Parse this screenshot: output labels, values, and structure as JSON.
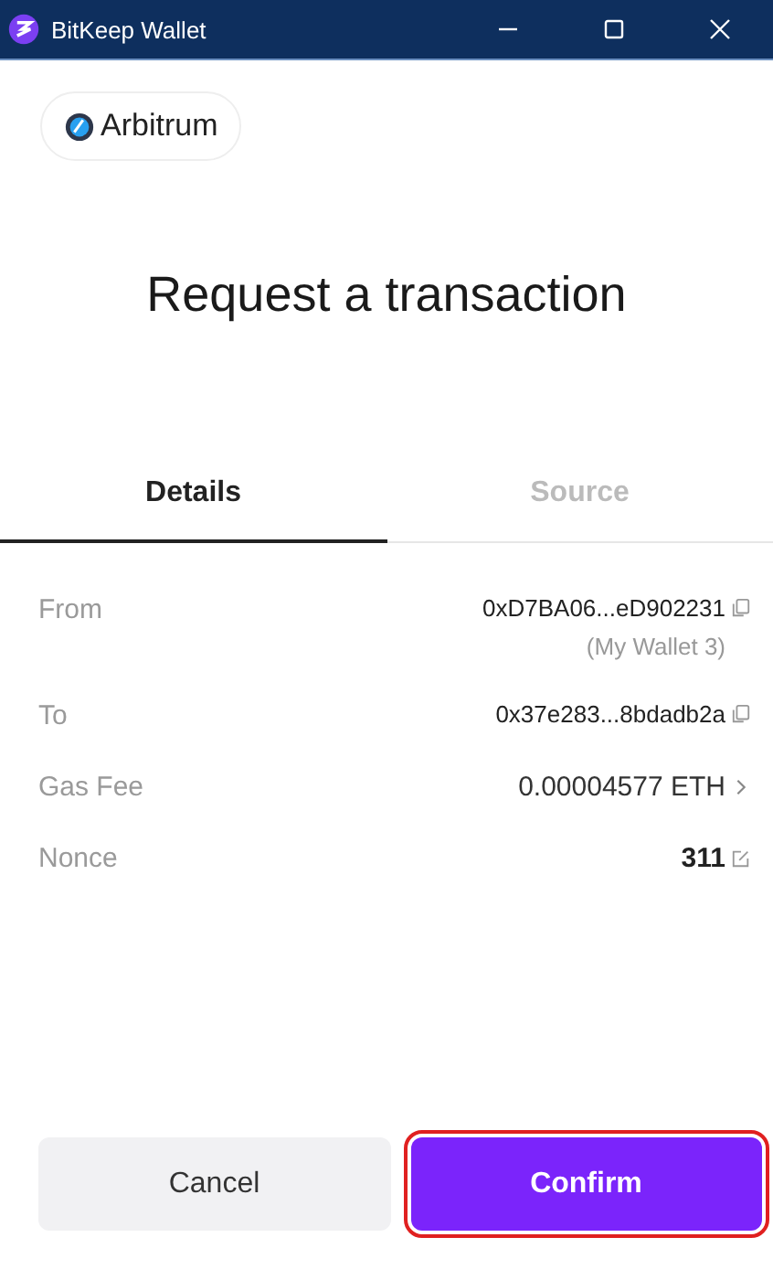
{
  "window": {
    "title": "BitKeep Wallet"
  },
  "network": {
    "name": "Arbitrum"
  },
  "heading": "Request a transaction",
  "tabs": [
    {
      "label": "Details",
      "selected": true
    },
    {
      "label": "Source",
      "selected": false
    }
  ],
  "rows": [
    {
      "label": "From",
      "value": "0xD7BA06...eD902231",
      "note": "(My Wallet 3)",
      "kind": "copy"
    },
    {
      "label": "To",
      "value": "0x37e283...8bdadb2a",
      "kind": "copy"
    },
    {
      "label": "Gas Fee",
      "value": "0.00004577 ETH",
      "kind": "chevron"
    },
    {
      "label": "Nonce",
      "value": "311",
      "kind": "edit"
    }
  ],
  "buttons": [
    {
      "label": "Cancel",
      "kind": "secondary",
      "highlighted": false
    },
    {
      "label": "Confirm",
      "kind": "primary",
      "highlighted": true
    }
  ]
}
